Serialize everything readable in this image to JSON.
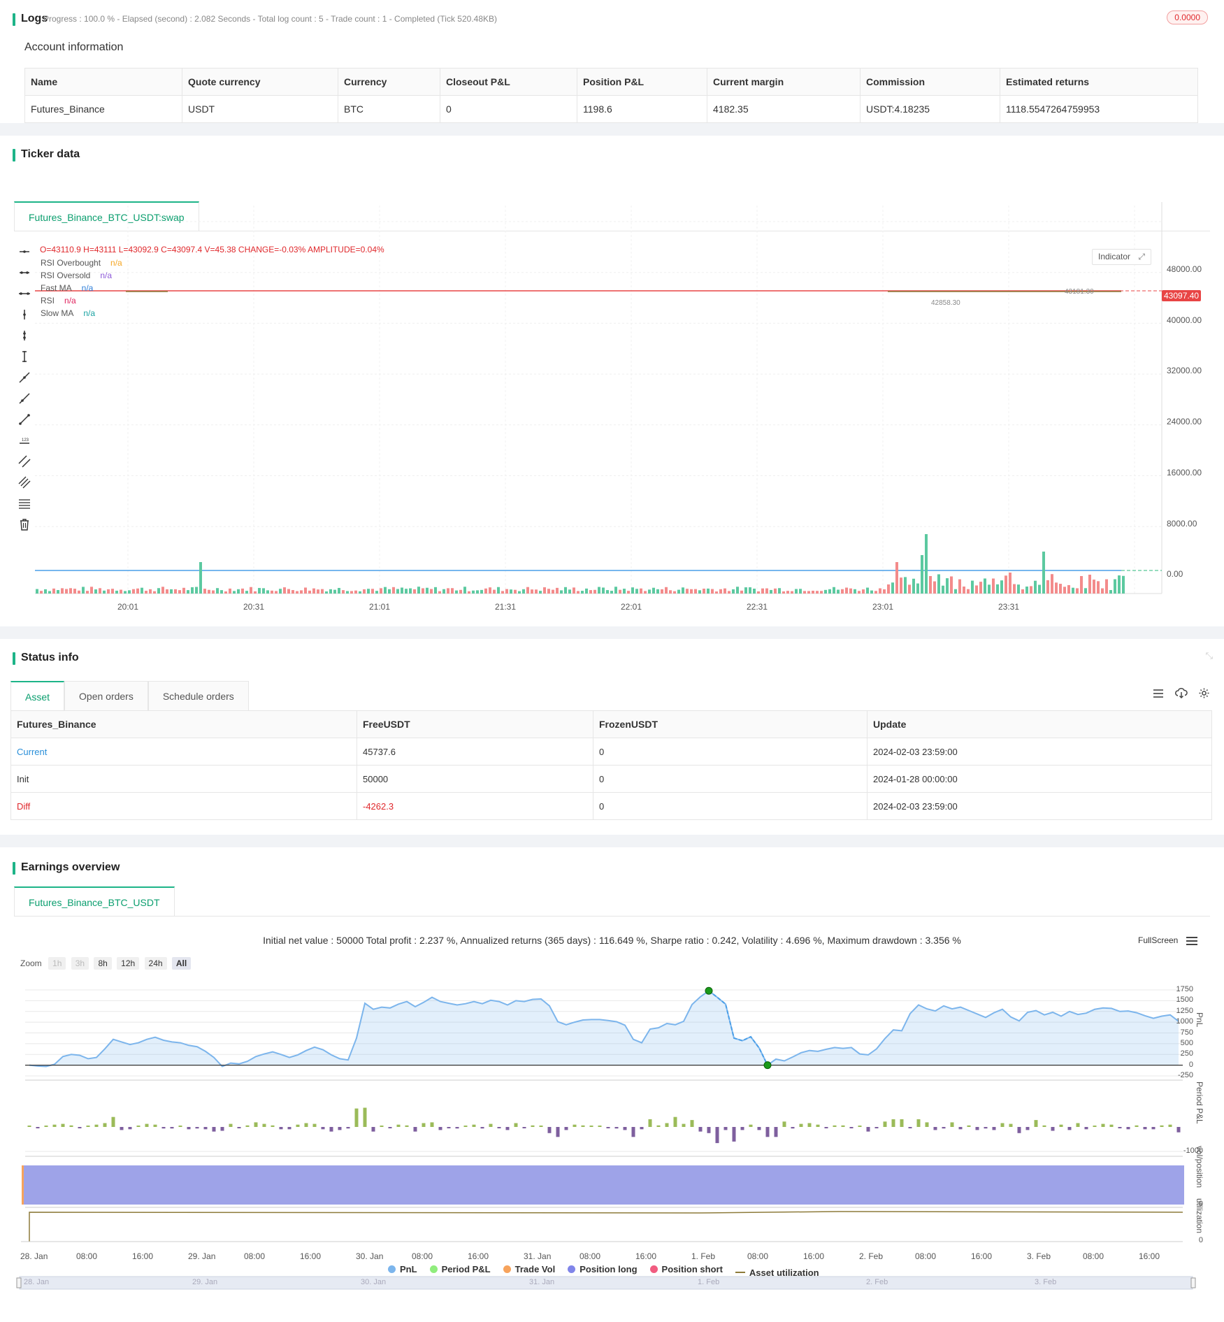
{
  "logs": {
    "title": "Logs",
    "progress": "Progress : 100.0 % - Elapsed (second) : 2.082  Seconds - Total log count : 5 - Trade count : 1 - Completed (Tick 520.48KB)",
    "badge": "0.0000",
    "account_title": "Account information",
    "columns": [
      "Name",
      "Quote currency",
      "Currency",
      "Closeout P&L",
      "Position P&L",
      "Current margin",
      "Commission",
      "Estimated returns"
    ],
    "row": [
      "Futures_Binance",
      "USDT",
      "BTC",
      "0",
      "1198.6",
      "4182.35",
      "USDT:4.18235",
      "1118.5547264759953"
    ]
  },
  "ticker": {
    "title": "Ticker data",
    "tab": "Futures_Binance_BTC_USDT:swap",
    "ohlc": "O=43110.9 H=43111 L=43092.9 C=43097.4 V=45.38 CHANGE=-0.03% AMPLITUDE=0.04%",
    "indicator_btn": "Indicator",
    "legend": [
      {
        "name": "RSI Overbought",
        "value": "n/a",
        "color": "#f5a623"
      },
      {
        "name": "RSI Oversold",
        "value": "n/a",
        "color": "#8e5ad9"
      },
      {
        "name": "Fast MA",
        "value": "n/a",
        "color": "#2f7fd9"
      },
      {
        "name": "RSI",
        "value": "n/a",
        "color": "#e0245e"
      },
      {
        "name": "Slow MA",
        "value": "n/a",
        "color": "#1aa3a3"
      }
    ],
    "price_tag": "43097.40",
    "high_label": "43181.30",
    "low_label": "42858.30",
    "y_ticks": [
      "48000.00",
      "40000.00",
      "32000.00",
      "24000.00",
      "16000.00",
      "8000.00",
      "0.00"
    ],
    "x_ticks": [
      "20:01",
      "20:31",
      "21:01",
      "21:31",
      "22:01",
      "22:31",
      "23:01",
      "23:31"
    ]
  },
  "status": {
    "title": "Status info",
    "tabs": [
      "Asset",
      "Open orders",
      "Schedule orders"
    ],
    "columns": [
      "Futures_Binance",
      "FreeUSDT",
      "FrozenUSDT",
      "Update"
    ],
    "rows": [
      {
        "name": "Current",
        "free": "45737.6",
        "frozen": "0",
        "update": "2024-02-03 23:59:00"
      },
      {
        "name": "Init",
        "free": "50000",
        "frozen": "0",
        "update": "2024-01-28 00:00:00"
      },
      {
        "name": "Diff",
        "free": "-4262.3",
        "frozen": "0",
        "update": "2024-02-03 23:59:00"
      }
    ]
  },
  "earnings": {
    "title": "Earnings overview",
    "tab": "Futures_Binance_BTC_USDT",
    "summary": "Initial net value : 50000 Total profit : 2.237 %, Annualized returns (365 days) : 116.649 %, Sharpe ratio : 0.242, Volatility : 4.696 %, Maximum drawdown : 3.356 %",
    "fullscreen": "FullScreen",
    "zoom_label": "Zoom",
    "zoom": [
      "1h",
      "3h",
      "8h",
      "12h",
      "24h",
      "All"
    ],
    "pnl_ticks": [
      "1750",
      "1500",
      "1250",
      "1000",
      "750",
      "500",
      "250",
      "0",
      "-250"
    ],
    "period_tick": "-1000",
    "vol_tick": "0",
    "util_tick": "0",
    "axis_labels": {
      "pnl": "PnL",
      "period": "Period P&L",
      "vol": "vol/position",
      "util": "utilization"
    },
    "x_ticks": [
      "28. Jan",
      "08:00",
      "16:00",
      "29. Jan",
      "08:00",
      "16:00",
      "30. Jan",
      "08:00",
      "16:00",
      "31. Jan",
      "08:00",
      "16:00",
      "1. Feb",
      "08:00",
      "16:00",
      "2. Feb",
      "08:00",
      "16:00",
      "3. Feb",
      "08:00",
      "16:00"
    ],
    "nav_ticks": [
      "28. Jan",
      "29. Jan",
      "30. Jan",
      "31. Jan",
      "1. Feb",
      "2. Feb",
      "3. Feb"
    ],
    "legend": [
      {
        "name": "PnL",
        "color": "#7cb5ec"
      },
      {
        "name": "Period P&L",
        "color": "#90ed7d"
      },
      {
        "name": "Trade Vol",
        "color": "#f7a35c"
      },
      {
        "name": "Position long",
        "color": "#8085e9"
      },
      {
        "name": "Position short",
        "color": "#f15c80"
      },
      {
        "name": "Asset utilization",
        "color": "#8d7b3a"
      }
    ]
  },
  "chart_data": {
    "type": "line",
    "title": "",
    "series": [
      {
        "name": "PnL",
        "values": [
          0,
          -20,
          -30,
          20,
          200,
          250,
          230,
          150,
          180,
          380,
          600,
          540,
          480,
          520,
          600,
          650,
          580,
          540,
          520,
          460,
          430,
          320,
          180,
          -30,
          50,
          30,
          90,
          200,
          260,
          310,
          250,
          180,
          240,
          340,
          420,
          360,
          240,
          150,
          120,
          630,
          1440,
          1300,
          1350,
          1330,
          1420,
          1480,
          1360,
          1460,
          1580,
          1480,
          1440,
          1400,
          1430,
          1480,
          1430,
          1510,
          1480,
          1400,
          1500,
          1480,
          1530,
          1540,
          1380,
          1010,
          940,
          1000,
          1050,
          1060,
          1060,
          1040,
          1010,
          930,
          600,
          520,
          840,
          870,
          970,
          940,
          1020,
          1410,
          1590,
          1730,
          1580,
          1420,
          630,
          570,
          660,
          400,
          0,
          140,
          100,
          190,
          290,
          340,
          320,
          370,
          410,
          390,
          410,
          260,
          240,
          380,
          620,
          820,
          800,
          1200,
          1400,
          1310,
          1260,
          1380,
          1310,
          1350,
          1270,
          1190,
          1110,
          1220,
          1300,
          1120,
          1030,
          1230,
          1270,
          1170,
          1230,
          1140,
          1250,
          1180,
          1210,
          1300,
          1330,
          1320,
          1250,
          1260,
          1220,
          1150,
          1090,
          1140,
          1170,
          1020
        ]
      },
      {
        "name": "Period P&L",
        "values": [
          20,
          -30,
          0,
          60,
          80,
          40,
          -20,
          20,
          60,
          100,
          260,
          -80,
          -60,
          30,
          80,
          60,
          -40,
          -40,
          20,
          -60,
          -40,
          -60,
          -120,
          -100,
          80,
          -20,
          40,
          120,
          80,
          40,
          -60,
          -60,
          60,
          100,
          80,
          -60,
          -120,
          -80,
          -40,
          480,
          500,
          -120,
          30,
          -20,
          60,
          40,
          -120,
          100,
          120,
          -80,
          -30,
          -40,
          30,
          60,
          -40,
          80,
          -30,
          -80,
          100,
          -20,
          40,
          20,
          -160,
          -260,
          -80,
          60,
          40,
          20,
          0,
          -20,
          -40,
          -80,
          -260,
          -60,
          200,
          40,
          100,
          260,
          80,
          180,
          -120,
          -160,
          -420,
          -80,
          -380,
          -80,
          60,
          -80,
          -260,
          -260,
          140,
          -40,
          80,
          100,
          60,
          -20,
          40,
          40,
          -20,
          20,
          -120,
          -20,
          140,
          200,
          200,
          -20,
          200,
          120,
          -80,
          -40,
          120,
          -60,
          40,
          -80,
          -40,
          -80,
          100,
          80,
          -160,
          -80,
          180,
          40,
          -100,
          60,
          -80,
          100,
          -60,
          20,
          80,
          60,
          -10,
          -60,
          40,
          -60,
          -60,
          40,
          60,
          -140
        ]
      },
      {
        "name": "Asset utilization",
        "values": [
          0,
          8.4,
          8.4,
          8.3,
          8.4,
          8.4,
          8.4
        ]
      }
    ],
    "ylim": [
      -250,
      1750
    ]
  }
}
